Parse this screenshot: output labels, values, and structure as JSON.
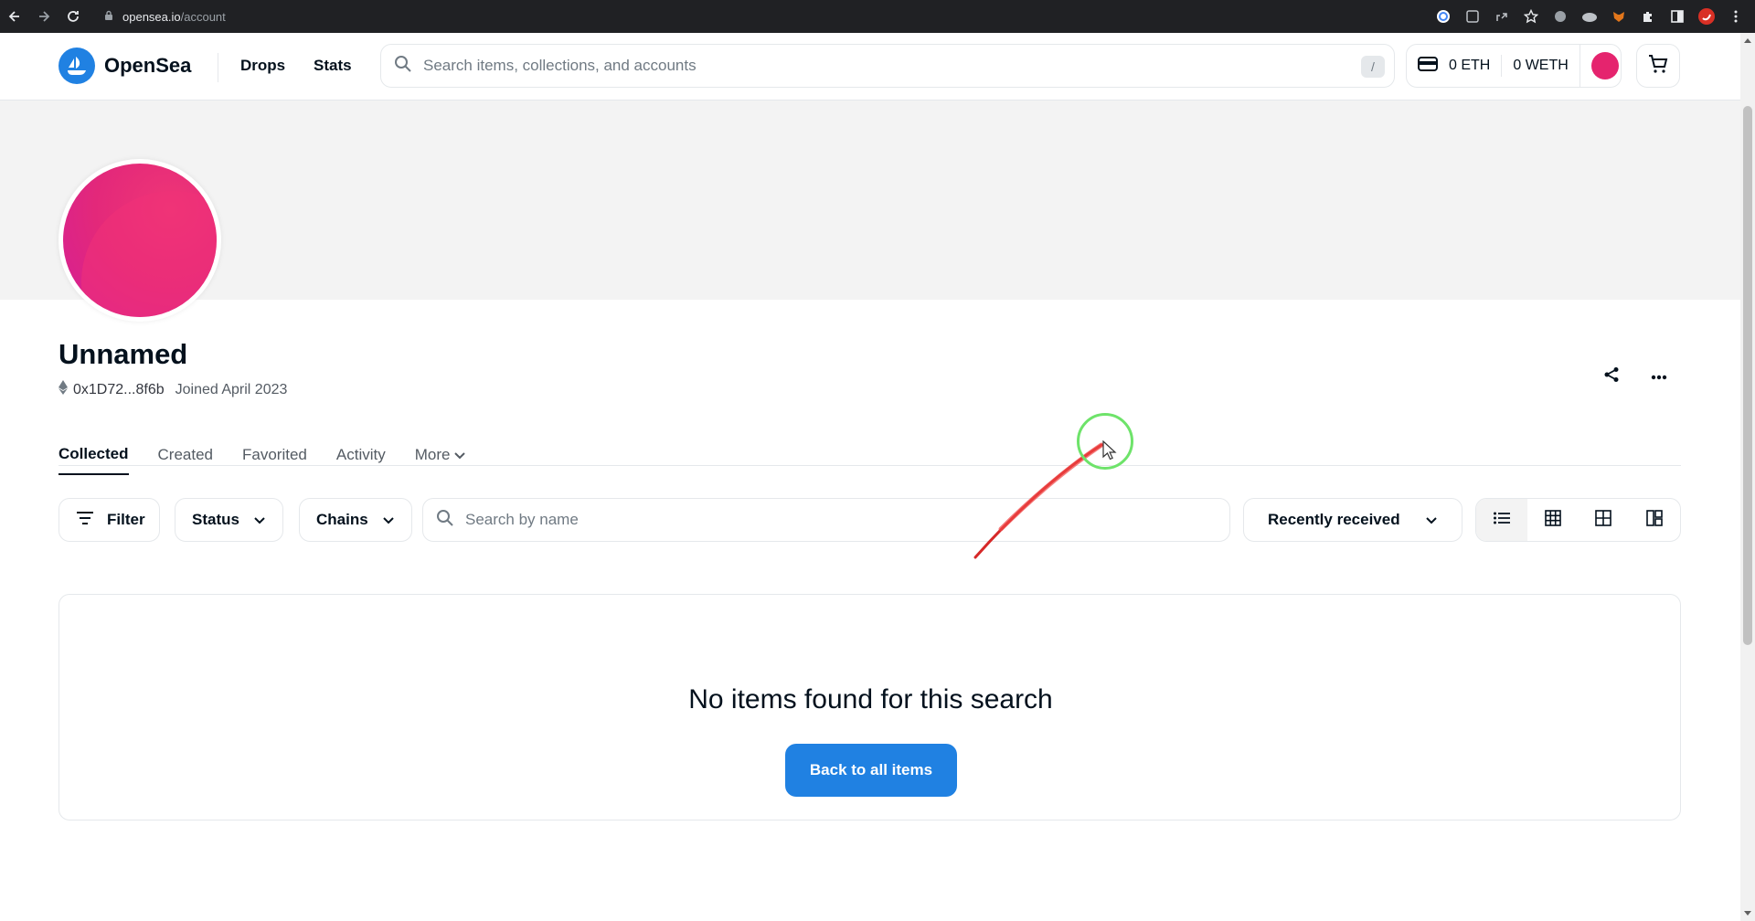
{
  "browser": {
    "url_host": "opensea.io",
    "url_path": "/account"
  },
  "header": {
    "brand": "OpenSea",
    "nav": [
      "Drops",
      "Stats"
    ],
    "search_placeholder": "Search items, collections, and accounts",
    "search_shortcut": "/",
    "wallet_eth": "0 ETH",
    "wallet_weth": "0 WETH"
  },
  "profile": {
    "name": "Unnamed",
    "address": "0x1D72...8f6b",
    "joined": "Joined April 2023"
  },
  "tabs": [
    "Collected",
    "Created",
    "Favorited",
    "Activity",
    "More"
  ],
  "toolbar": {
    "filter": "Filter",
    "status": "Status",
    "chains": "Chains",
    "search_placeholder": "Search by name",
    "sort": "Recently received"
  },
  "empty": {
    "title": "No items found for this search",
    "button": "Back to all items"
  },
  "colors": {
    "accent": "#2081e2",
    "avatar": "#e5246e"
  }
}
